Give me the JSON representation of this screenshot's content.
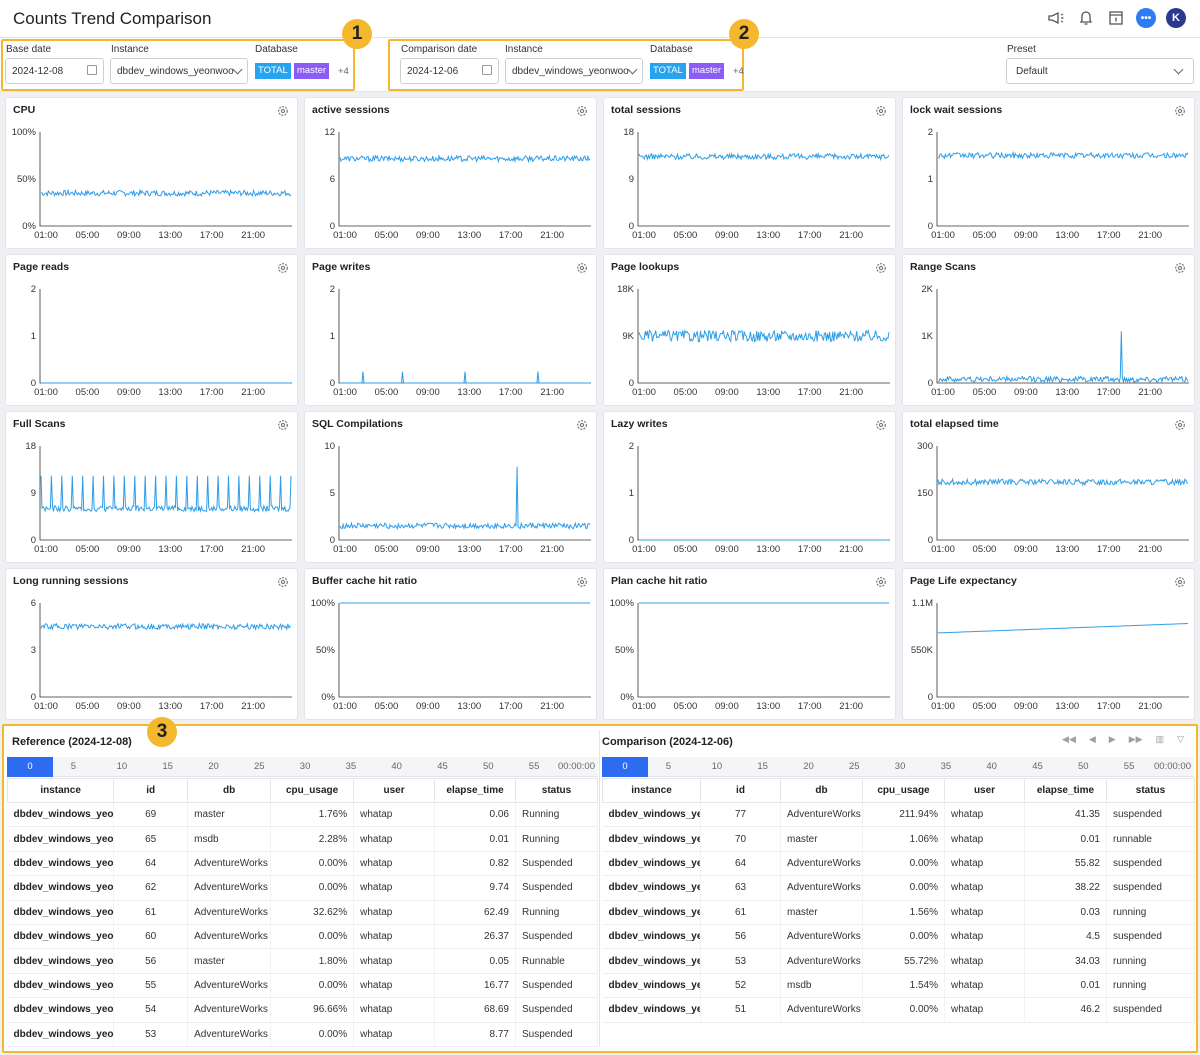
{
  "header": {
    "title": "Counts Trend Comparison"
  },
  "base": {
    "badge": "1",
    "date_label": "Base date",
    "date": "2024-12-08",
    "instance_label": "Instance",
    "instance": "dbdev_windows_yeonwoo",
    "db_label": "Database",
    "tags": [
      "TOTAL",
      "master"
    ],
    "more": "+4"
  },
  "comparison": {
    "badge": "2",
    "date_label": "Comparison date",
    "date": "2024-12-06",
    "instance_label": "Instance",
    "instance": "dbdev_windows_yeonwoo",
    "db_label": "Database",
    "tags": [
      "TOTAL",
      "master"
    ],
    "more": "+4"
  },
  "preset": {
    "label": "Preset",
    "value": "Default"
  },
  "chart_data": [
    {
      "title": "CPU",
      "type": "line",
      "y_ticks": [
        "100%",
        "50%",
        "0%"
      ],
      "ylim": [
        0,
        100
      ],
      "x_ticks": [
        "01:00",
        "05:00",
        "09:00",
        "13:00",
        "17:00",
        "21:00"
      ],
      "series": [
        {
          "values_approx": 35
        }
      ]
    },
    {
      "title": "active sessions",
      "type": "line",
      "y_ticks": [
        "12",
        "6",
        "0"
      ],
      "ylim": [
        0,
        12
      ],
      "x_ticks": [
        "01:00",
        "05:00",
        "09:00",
        "13:00",
        "17:00",
        "21:00"
      ],
      "series": [
        {
          "values_approx": 8.6
        }
      ]
    },
    {
      "title": "total sessions",
      "type": "line",
      "y_ticks": [
        "18",
        "9",
        "0"
      ],
      "ylim": [
        0,
        18
      ],
      "x_ticks": [
        "01:00",
        "05:00",
        "09:00",
        "13:00",
        "17:00",
        "21:00"
      ],
      "series": [
        {
          "values_approx": 13.3
        }
      ]
    },
    {
      "title": "lock wait sessions",
      "type": "line",
      "y_ticks": [
        "2",
        "1",
        "0"
      ],
      "ylim": [
        0,
        2
      ],
      "x_ticks": [
        "01:00",
        "05:00",
        "09:00",
        "13:00",
        "17:00",
        "21:00"
      ],
      "series": [
        {
          "values_approx": 1.5
        }
      ]
    },
    {
      "title": "Page reads",
      "type": "line",
      "y_ticks": [
        "2",
        "1",
        "0"
      ],
      "ylim": [
        0,
        2
      ],
      "x_ticks": [
        "01:00",
        "05:00",
        "09:00",
        "13:00",
        "17:00",
        "21:00"
      ],
      "series": [
        {
          "values_approx": 0
        }
      ]
    },
    {
      "title": "Page writes",
      "type": "line",
      "y_ticks": [
        "2",
        "1",
        "0"
      ],
      "ylim": [
        0,
        2
      ],
      "x_ticks": [
        "01:00",
        "05:00",
        "09:00",
        "13:00",
        "17:00",
        "21:00"
      ],
      "series": [
        {
          "values_approx": 0
        }
      ]
    },
    {
      "title": "Page lookups",
      "type": "line",
      "y_ticks": [
        "18K",
        "9K",
        "0"
      ],
      "ylim": [
        0,
        18000
      ],
      "x_ticks": [
        "01:00",
        "05:00",
        "09:00",
        "13:00",
        "17:00",
        "21:00"
      ],
      "series": [
        {
          "values_approx": 9000
        }
      ]
    },
    {
      "title": "Range Scans",
      "type": "line",
      "y_ticks": [
        "2K",
        "1K",
        "0"
      ],
      "ylim": [
        0,
        2000
      ],
      "x_ticks": [
        "01:00",
        "05:00",
        "09:00",
        "13:00",
        "17:00",
        "21:00"
      ],
      "series": [
        {
          "values_approx": 80
        }
      ]
    },
    {
      "title": "Full Scans",
      "type": "line",
      "y_ticks": [
        "18",
        "9",
        "0"
      ],
      "ylim": [
        0,
        18
      ],
      "x_ticks": [
        "01:00",
        "05:00",
        "09:00",
        "13:00",
        "17:00",
        "21:00"
      ],
      "series": [
        {
          "values_approx": 6
        }
      ]
    },
    {
      "title": "SQL Compilations",
      "type": "line",
      "y_ticks": [
        "10",
        "5",
        "0"
      ],
      "ylim": [
        0,
        10
      ],
      "x_ticks": [
        "01:00",
        "05:00",
        "09:00",
        "13:00",
        "17:00",
        "21:00"
      ],
      "series": [
        {
          "values_approx": 1.5
        }
      ]
    },
    {
      "title": "Lazy writes",
      "type": "line",
      "y_ticks": [
        "2",
        "1",
        "0"
      ],
      "ylim": [
        0,
        2
      ],
      "x_ticks": [
        "01:00",
        "05:00",
        "09:00",
        "13:00",
        "17:00",
        "21:00"
      ],
      "series": [
        {
          "values_approx": 0
        }
      ]
    },
    {
      "title": "total elapsed time",
      "type": "line",
      "y_ticks": [
        "300",
        "150",
        "0"
      ],
      "ylim": [
        0,
        300
      ],
      "x_ticks": [
        "01:00",
        "05:00",
        "09:00",
        "13:00",
        "17:00",
        "21:00"
      ],
      "series": [
        {
          "values_approx": 185
        }
      ]
    },
    {
      "title": "Long running sessions",
      "type": "line",
      "y_ticks": [
        "6",
        "3",
        "0"
      ],
      "ylim": [
        0,
        6
      ],
      "x_ticks": [
        "01:00",
        "05:00",
        "09:00",
        "13:00",
        "17:00",
        "21:00"
      ],
      "series": [
        {
          "values_approx": 4.5
        }
      ]
    },
    {
      "title": "Buffer cache hit ratio",
      "type": "line",
      "y_ticks": [
        "100%",
        "50%",
        "0%"
      ],
      "ylim": [
        0,
        100
      ],
      "x_ticks": [
        "01:00",
        "05:00",
        "09:00",
        "13:00",
        "17:00",
        "21:00"
      ],
      "series": [
        {
          "values_approx": 100
        }
      ]
    },
    {
      "title": "Plan cache hit ratio",
      "type": "line",
      "y_ticks": [
        "100%",
        "50%",
        "0%"
      ],
      "ylim": [
        0,
        100
      ],
      "x_ticks": [
        "01:00",
        "05:00",
        "09:00",
        "13:00",
        "17:00",
        "21:00"
      ],
      "series": [
        {
          "values_approx": 100
        }
      ]
    },
    {
      "title": "Page Life expectancy",
      "type": "line",
      "y_ticks": [
        "1.1M",
        "550K",
        "0"
      ],
      "ylim": [
        0,
        1100000
      ],
      "x_ticks": [
        "01:00",
        "05:00",
        "09:00",
        "13:00",
        "17:00",
        "21:00"
      ],
      "series": [
        {
          "values_approx": 750000
        }
      ]
    }
  ],
  "bottom": {
    "badge": "3",
    "timeline": [
      "0",
      "5",
      "10",
      "15",
      "20",
      "25",
      "30",
      "35",
      "40",
      "45",
      "50",
      "55",
      "00:00:00"
    ],
    "columns": [
      "instance",
      "id",
      "db",
      "cpu_usage",
      "user",
      "elapse_time",
      "status"
    ],
    "reference": {
      "title": "Reference (2024-12-08)",
      "rows": [
        [
          "dbdev_windows_yeonwoo",
          "69",
          "master",
          "1.76%",
          "whatap",
          "0.06",
          "Running"
        ],
        [
          "dbdev_windows_yeonwoo",
          "65",
          "msdb",
          "2.28%",
          "whatap",
          "0.01",
          "Running"
        ],
        [
          "dbdev_windows_yeonwoo",
          "64",
          "AdventureWorks",
          "0.00%",
          "whatap",
          "0.82",
          "Suspended"
        ],
        [
          "dbdev_windows_yeonwoo",
          "62",
          "AdventureWorks",
          "0.00%",
          "whatap",
          "9.74",
          "Suspended"
        ],
        [
          "dbdev_windows_yeonwoo",
          "61",
          "AdventureWorks",
          "32.62%",
          "whatap",
          "62.49",
          "Running"
        ],
        [
          "dbdev_windows_yeonwoo",
          "60",
          "AdventureWorks",
          "0.00%",
          "whatap",
          "26.37",
          "Suspended"
        ],
        [
          "dbdev_windows_yeonwoo",
          "56",
          "master",
          "1.80%",
          "whatap",
          "0.05",
          "Runnable"
        ],
        [
          "dbdev_windows_yeonwoo",
          "55",
          "AdventureWorks",
          "0.00%",
          "whatap",
          "16.77",
          "Suspended"
        ],
        [
          "dbdev_windows_yeonwoo",
          "54",
          "AdventureWorks",
          "96.66%",
          "whatap",
          "68.69",
          "Suspended"
        ],
        [
          "dbdev_windows_yeonwoo",
          "53",
          "AdventureWorks",
          "0.00%",
          "whatap",
          "8.77",
          "Suspended"
        ]
      ]
    },
    "comparison": {
      "title": "Comparison (2024-12-06)",
      "rows": [
        [
          "dbdev_windows_yeonwoo",
          "77",
          "AdventureWorks",
          "211.94%",
          "whatap",
          "41.35",
          "suspended"
        ],
        [
          "dbdev_windows_yeonwoo",
          "70",
          "master",
          "1.06%",
          "whatap",
          "0.01",
          "runnable"
        ],
        [
          "dbdev_windows_yeonwoo",
          "64",
          "AdventureWorks",
          "0.00%",
          "whatap",
          "55.82",
          "suspended"
        ],
        [
          "dbdev_windows_yeonwoo",
          "63",
          "AdventureWorks",
          "0.00%",
          "whatap",
          "38.22",
          "suspended"
        ],
        [
          "dbdev_windows_yeonwoo",
          "61",
          "master",
          "1.56%",
          "whatap",
          "0.03",
          "running"
        ],
        [
          "dbdev_windows_yeonwoo",
          "56",
          "AdventureWorks",
          "0.00%",
          "whatap",
          "4.5",
          "suspended"
        ],
        [
          "dbdev_windows_yeonwoo",
          "53",
          "AdventureWorks",
          "55.72%",
          "whatap",
          "34.03",
          "running"
        ],
        [
          "dbdev_windows_yeonwoo",
          "52",
          "msdb",
          "1.54%",
          "whatap",
          "0.01",
          "running"
        ],
        [
          "dbdev_windows_yeonwoo",
          "51",
          "AdventureWorks",
          "0.00%",
          "whatap",
          "46.2",
          "suspended"
        ]
      ]
    }
  },
  "colors": {
    "accent": "#2d6cf0",
    "highlight": "#f4b82f",
    "series": "#2e9de8",
    "tag_total": "#26a4f0",
    "tag_master": "#8b5cf6"
  }
}
